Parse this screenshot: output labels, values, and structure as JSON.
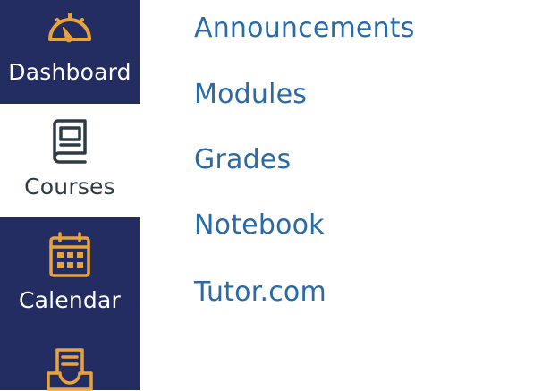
{
  "global_nav": {
    "items": [
      {
        "label": "Dashboard",
        "icon": "speedometer-icon",
        "active": false
      },
      {
        "label": "Courses",
        "icon": "book-icon",
        "active": true
      },
      {
        "label": "Calendar",
        "icon": "calendar-icon",
        "active": false
      },
      {
        "label": "",
        "icon": "inbox-icon",
        "active": false
      }
    ],
    "colors": {
      "background": "#232d62",
      "icon": "#e8a33d",
      "active_background": "#ffffff",
      "active_text": "#2d3b45"
    }
  },
  "course_menu": {
    "links": [
      {
        "label": "Announcements"
      },
      {
        "label": "Modules"
      },
      {
        "label": "Grades"
      },
      {
        "label": "Notebook"
      },
      {
        "label": "Tutor.com"
      }
    ],
    "link_color": "#2a6aa7"
  }
}
